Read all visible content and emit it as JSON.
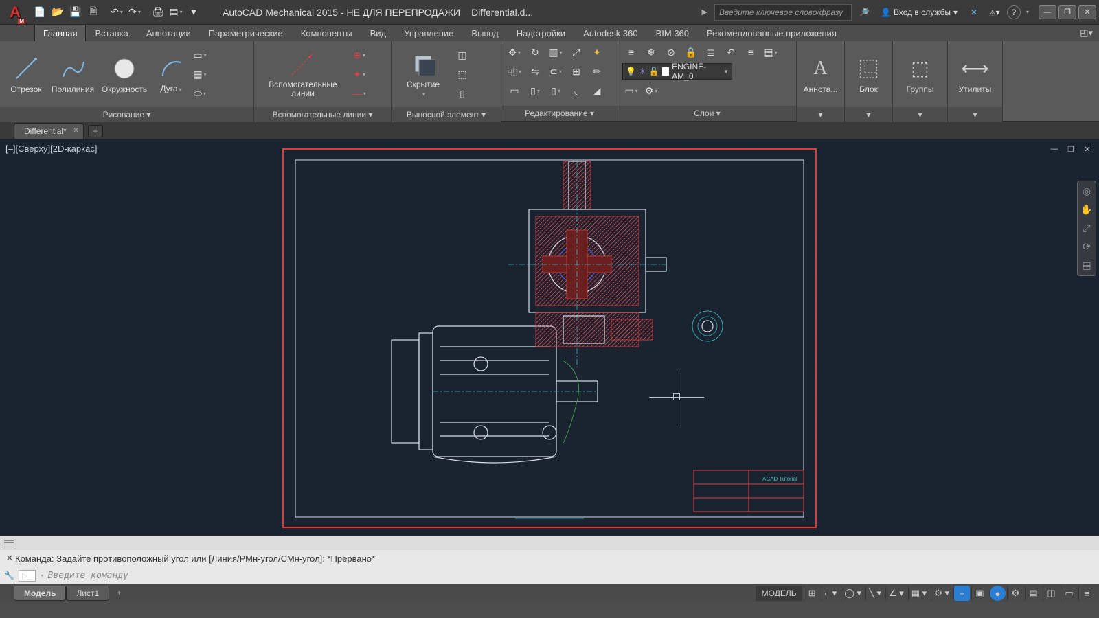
{
  "app": {
    "title": "AutoCAD Mechanical 2015 - НЕ ДЛЯ ПЕРЕПРОДАЖИ",
    "document_short": "Differential.d...",
    "search_placeholder": "Введите ключевое слово/фразу",
    "signin": "Вход в службы"
  },
  "qat": [
    "new",
    "open",
    "save",
    "save-as",
    "undo",
    "redo",
    "print",
    "plot-preview"
  ],
  "tabs": [
    "Главная",
    "Вставка",
    "Аннотации",
    "Параметрические",
    "Компоненты",
    "Вид",
    "Управление",
    "Вывод",
    "Надстройки",
    "Autodesk 360",
    "BIM 360",
    "Рекомендованные приложения"
  ],
  "active_tab": 0,
  "ribbon": {
    "draw": {
      "title": "Рисование",
      "items": [
        "Отрезок",
        "Полилиния",
        "Окружность",
        "Дуга"
      ]
    },
    "construction": {
      "title": "Вспомогательные линии",
      "big": "Вспомогательные\nлинии"
    },
    "detail": {
      "title": "Выносной элемент",
      "big": "Скрытие"
    },
    "modify": {
      "title": "Редактирование"
    },
    "layers": {
      "title": "Слои",
      "current": "ENGINE-AM_0"
    },
    "annotation": {
      "title": "Аннота..."
    },
    "block": {
      "title": "Блок"
    },
    "groups": {
      "title": "Группы"
    },
    "utilities": {
      "title": "Утилиты"
    }
  },
  "doc_tabs": {
    "active": "Differential*"
  },
  "viewport": {
    "label": "[–][Сверху][2D-каркас]"
  },
  "command": {
    "history": "Команда: Задайте противоположный угол или [Линия/РМн-угол/СМн-угол]: *Прервано*",
    "placeholder": "Введите команду"
  },
  "model_tabs": [
    "Модель",
    "Лист1"
  ],
  "active_model_tab": 0,
  "status": {
    "space": "МОДЕЛЬ"
  }
}
